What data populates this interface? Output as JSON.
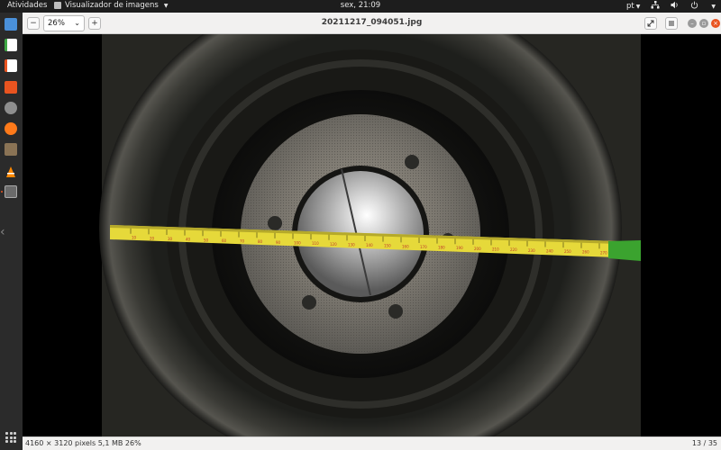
{
  "topbar": {
    "activities": "Atividades",
    "app_name": "Visualizador de imagens",
    "clock": "sex, 21:09",
    "language": "pt"
  },
  "dock": {
    "items": [
      {
        "name": "files",
        "color": "#4a90d9"
      },
      {
        "name": "spreadsheet",
        "color": "#3fa845"
      },
      {
        "name": "document",
        "color": "#f0f0f0"
      },
      {
        "name": "software-store",
        "color": "#e95420"
      },
      {
        "name": "settings",
        "color": "#9e9e9e"
      },
      {
        "name": "firefox",
        "color": "#ff7a1a"
      },
      {
        "name": "files-cabinet",
        "color": "#8a7355"
      },
      {
        "name": "vlc",
        "color": "#ff8800"
      },
      {
        "name": "image-viewer",
        "color": "#6b6b6b"
      }
    ]
  },
  "header": {
    "zoom_value": "26%",
    "zoom_out": "−",
    "zoom_in": "+",
    "filename": "20211217_094051.jpg"
  },
  "status": {
    "info": "4160 × 3120 pixels  5,1 MB  26%",
    "position": "13 / 35"
  },
  "ruler": {
    "ticks": [
      "10",
      "20",
      "30",
      "40",
      "50",
      "60",
      "70",
      "80",
      "90",
      "100",
      "110",
      "120",
      "130",
      "140",
      "150",
      "160",
      "170",
      "180",
      "190",
      "200",
      "210",
      "220",
      "230",
      "240",
      "250",
      "260",
      "270"
    ]
  },
  "colors": {
    "accent": "#e95420",
    "tape": "#e6d93a",
    "disc": "#7a766e"
  }
}
